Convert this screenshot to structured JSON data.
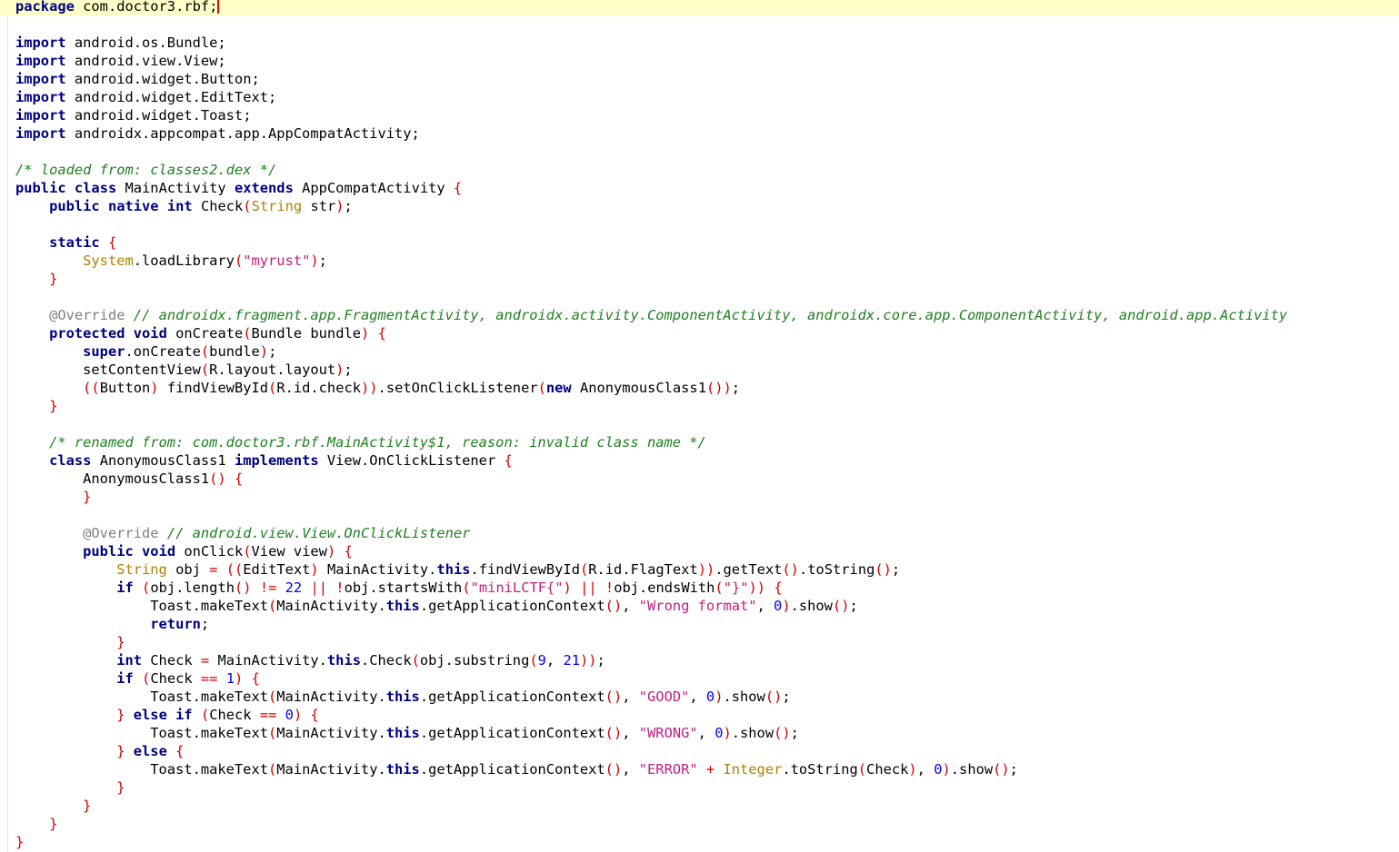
{
  "colors": {
    "keyword": "#000080",
    "bracket": "#d00000",
    "string": "#c02080",
    "number": "#0000ff",
    "comment": "#208020",
    "annotation": "#808080",
    "builtin_type": "#b08000",
    "current_line_bg": "#ffffc8"
  },
  "lines": [
    [
      {
        "t": "package",
        "c": "kw"
      },
      {
        "t": " com.doctor3.rbf;"
      }
    ],
    [],
    [
      {
        "t": "import",
        "c": "kw"
      },
      {
        "t": " android.os.Bundle;"
      }
    ],
    [
      {
        "t": "import",
        "c": "kw"
      },
      {
        "t": " android.view.View;"
      }
    ],
    [
      {
        "t": "import",
        "c": "kw"
      },
      {
        "t": " android.widget.Button;"
      }
    ],
    [
      {
        "t": "import",
        "c": "kw"
      },
      {
        "t": " android.widget.EditText;"
      }
    ],
    [
      {
        "t": "import",
        "c": "kw"
      },
      {
        "t": " android.widget.Toast;"
      }
    ],
    [
      {
        "t": "import",
        "c": "kw"
      },
      {
        "t": " androidx.appcompat.app.AppCompatActivity;"
      }
    ],
    [],
    [
      {
        "t": "/* loaded from: classes2.dex */",
        "c": "cmt"
      }
    ],
    [
      {
        "t": "public",
        "c": "kw"
      },
      {
        "t": " "
      },
      {
        "t": "class",
        "c": "kw"
      },
      {
        "t": " MainActivity "
      },
      {
        "t": "extends",
        "c": "kw"
      },
      {
        "t": " AppCompatActivity "
      },
      {
        "t": "{",
        "c": "br"
      }
    ],
    [
      {
        "t": "    "
      },
      {
        "t": "public",
        "c": "kw"
      },
      {
        "t": " "
      },
      {
        "t": "native",
        "c": "kw"
      },
      {
        "t": " "
      },
      {
        "t": "int",
        "c": "ty"
      },
      {
        "t": " Check"
      },
      {
        "t": "(",
        "c": "br"
      },
      {
        "t": "String",
        "c": "tk"
      },
      {
        "t": " str"
      },
      {
        "t": ")",
        "c": "br"
      },
      {
        "t": ";"
      }
    ],
    [],
    [
      {
        "t": "    "
      },
      {
        "t": "static",
        "c": "kw"
      },
      {
        "t": " "
      },
      {
        "t": "{",
        "c": "br"
      }
    ],
    [
      {
        "t": "        "
      },
      {
        "t": "System",
        "c": "tk"
      },
      {
        "t": ".loadLibrary"
      },
      {
        "t": "(",
        "c": "br"
      },
      {
        "t": "\"myrust\"",
        "c": "str"
      },
      {
        "t": ")",
        "c": "br"
      },
      {
        "t": ";"
      }
    ],
    [
      {
        "t": "    "
      },
      {
        "t": "}",
        "c": "br"
      }
    ],
    [],
    [
      {
        "t": "    "
      },
      {
        "t": "@Override",
        "c": "ann"
      },
      {
        "t": " "
      },
      {
        "t": "// androidx.fragment.app.FragmentActivity, androidx.activity.ComponentActivity, androidx.core.app.ComponentActivity, android.app.Activity",
        "c": "cmt"
      }
    ],
    [
      {
        "t": "    "
      },
      {
        "t": "protected",
        "c": "kw"
      },
      {
        "t": " "
      },
      {
        "t": "void",
        "c": "ty"
      },
      {
        "t": " onCreate"
      },
      {
        "t": "(",
        "c": "br"
      },
      {
        "t": "Bundle bundle"
      },
      {
        "t": ")",
        "c": "br"
      },
      {
        "t": " "
      },
      {
        "t": "{",
        "c": "br"
      }
    ],
    [
      {
        "t": "        "
      },
      {
        "t": "super",
        "c": "kw"
      },
      {
        "t": ".onCreate"
      },
      {
        "t": "(",
        "c": "br"
      },
      {
        "t": "bundle"
      },
      {
        "t": ")",
        "c": "br"
      },
      {
        "t": ";"
      }
    ],
    [
      {
        "t": "        setContentView"
      },
      {
        "t": "(",
        "c": "br"
      },
      {
        "t": "R.layout.layout"
      },
      {
        "t": ")",
        "c": "br"
      },
      {
        "t": ";"
      }
    ],
    [
      {
        "t": "        "
      },
      {
        "t": "((",
        "c": "br"
      },
      {
        "t": "Button"
      },
      {
        "t": ")",
        "c": "br"
      },
      {
        "t": " findViewById"
      },
      {
        "t": "(",
        "c": "br"
      },
      {
        "t": "R.id.check"
      },
      {
        "t": "))",
        "c": "br"
      },
      {
        "t": ".setOnClickListener"
      },
      {
        "t": "(",
        "c": "br"
      },
      {
        "t": "new",
        "c": "kw"
      },
      {
        "t": " AnonymousClass1"
      },
      {
        "t": "())",
        "c": "br"
      },
      {
        "t": ";"
      }
    ],
    [
      {
        "t": "    "
      },
      {
        "t": "}",
        "c": "br"
      }
    ],
    [],
    [
      {
        "t": "    "
      },
      {
        "t": "/* renamed from: com.doctor3.rbf.MainActivity$1, reason: invalid class name */",
        "c": "cmt"
      }
    ],
    [
      {
        "t": "    "
      },
      {
        "t": "class",
        "c": "kw"
      },
      {
        "t": " AnonymousClass1 "
      },
      {
        "t": "implements",
        "c": "kw"
      },
      {
        "t": " View.OnClickListener "
      },
      {
        "t": "{",
        "c": "br"
      }
    ],
    [
      {
        "t": "        AnonymousClass1"
      },
      {
        "t": "()",
        "c": "br"
      },
      {
        "t": " "
      },
      {
        "t": "{",
        "c": "br"
      }
    ],
    [
      {
        "t": "        "
      },
      {
        "t": "}",
        "c": "br"
      }
    ],
    [],
    [
      {
        "t": "        "
      },
      {
        "t": "@Override",
        "c": "ann"
      },
      {
        "t": " "
      },
      {
        "t": "// android.view.View.OnClickListener",
        "c": "cmt"
      }
    ],
    [
      {
        "t": "        "
      },
      {
        "t": "public",
        "c": "kw"
      },
      {
        "t": " "
      },
      {
        "t": "void",
        "c": "ty"
      },
      {
        "t": " onClick"
      },
      {
        "t": "(",
        "c": "br"
      },
      {
        "t": "View view"
      },
      {
        "t": ")",
        "c": "br"
      },
      {
        "t": " "
      },
      {
        "t": "{",
        "c": "br"
      }
    ],
    [
      {
        "t": "            "
      },
      {
        "t": "String",
        "c": "tk"
      },
      {
        "t": " obj "
      },
      {
        "t": "=",
        "c": "br"
      },
      {
        "t": " "
      },
      {
        "t": "((",
        "c": "br"
      },
      {
        "t": "EditText"
      },
      {
        "t": ")",
        "c": "br"
      },
      {
        "t": " MainActivity."
      },
      {
        "t": "this",
        "c": "kw"
      },
      {
        "t": ".findViewById"
      },
      {
        "t": "(",
        "c": "br"
      },
      {
        "t": "R.id.FlagText"
      },
      {
        "t": "))",
        "c": "br"
      },
      {
        "t": ".getText"
      },
      {
        "t": "()",
        "c": "br"
      },
      {
        "t": ".toString"
      },
      {
        "t": "()",
        "c": "br"
      },
      {
        "t": ";"
      }
    ],
    [
      {
        "t": "            "
      },
      {
        "t": "if",
        "c": "kw"
      },
      {
        "t": " "
      },
      {
        "t": "(",
        "c": "br"
      },
      {
        "t": "obj.length"
      },
      {
        "t": "()",
        "c": "br"
      },
      {
        "t": " "
      },
      {
        "t": "!=",
        "c": "br"
      },
      {
        "t": " "
      },
      {
        "t": "22",
        "c": "num"
      },
      {
        "t": " "
      },
      {
        "t": "||",
        "c": "br"
      },
      {
        "t": " "
      },
      {
        "t": "!",
        "c": "br"
      },
      {
        "t": "obj.startsWith"
      },
      {
        "t": "(",
        "c": "br"
      },
      {
        "t": "\"miniLCTF{\"",
        "c": "str"
      },
      {
        "t": ")",
        "c": "br"
      },
      {
        "t": " "
      },
      {
        "t": "||",
        "c": "br"
      },
      {
        "t": " "
      },
      {
        "t": "!",
        "c": "br"
      },
      {
        "t": "obj.endsWith"
      },
      {
        "t": "(",
        "c": "br"
      },
      {
        "t": "\"}\"",
        "c": "str"
      },
      {
        "t": "))",
        "c": "br"
      },
      {
        "t": " "
      },
      {
        "t": "{",
        "c": "br"
      }
    ],
    [
      {
        "t": "                Toast.makeText"
      },
      {
        "t": "(",
        "c": "br"
      },
      {
        "t": "MainActivity."
      },
      {
        "t": "this",
        "c": "kw"
      },
      {
        "t": ".getApplicationContext"
      },
      {
        "t": "()",
        "c": "br"
      },
      {
        "t": ", "
      },
      {
        "t": "\"Wrong format\"",
        "c": "str"
      },
      {
        "t": ", "
      },
      {
        "t": "0",
        "c": "num"
      },
      {
        "t": ")",
        "c": "br"
      },
      {
        "t": ".show"
      },
      {
        "t": "()",
        "c": "br"
      },
      {
        "t": ";"
      }
    ],
    [
      {
        "t": "                "
      },
      {
        "t": "return",
        "c": "kw"
      },
      {
        "t": ";"
      }
    ],
    [
      {
        "t": "            "
      },
      {
        "t": "}",
        "c": "br"
      }
    ],
    [
      {
        "t": "            "
      },
      {
        "t": "int",
        "c": "ty"
      },
      {
        "t": " Check "
      },
      {
        "t": "=",
        "c": "br"
      },
      {
        "t": " MainActivity."
      },
      {
        "t": "this",
        "c": "kw"
      },
      {
        "t": ".Check"
      },
      {
        "t": "(",
        "c": "br"
      },
      {
        "t": "obj.substring"
      },
      {
        "t": "(",
        "c": "br"
      },
      {
        "t": "9",
        "c": "num"
      },
      {
        "t": ", "
      },
      {
        "t": "21",
        "c": "num"
      },
      {
        "t": "))",
        "c": "br"
      },
      {
        "t": ";"
      }
    ],
    [
      {
        "t": "            "
      },
      {
        "t": "if",
        "c": "kw"
      },
      {
        "t": " "
      },
      {
        "t": "(",
        "c": "br"
      },
      {
        "t": "Check "
      },
      {
        "t": "==",
        "c": "br"
      },
      {
        "t": " "
      },
      {
        "t": "1",
        "c": "num"
      },
      {
        "t": ")",
        "c": "br"
      },
      {
        "t": " "
      },
      {
        "t": "{",
        "c": "br"
      }
    ],
    [
      {
        "t": "                Toast.makeText"
      },
      {
        "t": "(",
        "c": "br"
      },
      {
        "t": "MainActivity."
      },
      {
        "t": "this",
        "c": "kw"
      },
      {
        "t": ".getApplicationContext"
      },
      {
        "t": "()",
        "c": "br"
      },
      {
        "t": ", "
      },
      {
        "t": "\"GOOD\"",
        "c": "str"
      },
      {
        "t": ", "
      },
      {
        "t": "0",
        "c": "num"
      },
      {
        "t": ")",
        "c": "br"
      },
      {
        "t": ".show"
      },
      {
        "t": "()",
        "c": "br"
      },
      {
        "t": ";"
      }
    ],
    [
      {
        "t": "            "
      },
      {
        "t": "}",
        "c": "br"
      },
      {
        "t": " "
      },
      {
        "t": "else",
        "c": "kw"
      },
      {
        "t": " "
      },
      {
        "t": "if",
        "c": "kw"
      },
      {
        "t": " "
      },
      {
        "t": "(",
        "c": "br"
      },
      {
        "t": "Check "
      },
      {
        "t": "==",
        "c": "br"
      },
      {
        "t": " "
      },
      {
        "t": "0",
        "c": "num"
      },
      {
        "t": ")",
        "c": "br"
      },
      {
        "t": " "
      },
      {
        "t": "{",
        "c": "br"
      }
    ],
    [
      {
        "t": "                Toast.makeText"
      },
      {
        "t": "(",
        "c": "br"
      },
      {
        "t": "MainActivity."
      },
      {
        "t": "this",
        "c": "kw"
      },
      {
        "t": ".getApplicationContext"
      },
      {
        "t": "()",
        "c": "br"
      },
      {
        "t": ", "
      },
      {
        "t": "\"WRONG\"",
        "c": "str"
      },
      {
        "t": ", "
      },
      {
        "t": "0",
        "c": "num"
      },
      {
        "t": ")",
        "c": "br"
      },
      {
        "t": ".show"
      },
      {
        "t": "()",
        "c": "br"
      },
      {
        "t": ";"
      }
    ],
    [
      {
        "t": "            "
      },
      {
        "t": "}",
        "c": "br"
      },
      {
        "t": " "
      },
      {
        "t": "else",
        "c": "kw"
      },
      {
        "t": " "
      },
      {
        "t": "{",
        "c": "br"
      }
    ],
    [
      {
        "t": "                Toast.makeText"
      },
      {
        "t": "(",
        "c": "br"
      },
      {
        "t": "MainActivity."
      },
      {
        "t": "this",
        "c": "kw"
      },
      {
        "t": ".getApplicationContext"
      },
      {
        "t": "()",
        "c": "br"
      },
      {
        "t": ", "
      },
      {
        "t": "\"ERROR\"",
        "c": "str"
      },
      {
        "t": " "
      },
      {
        "t": "+",
        "c": "br"
      },
      {
        "t": " "
      },
      {
        "t": "Integer",
        "c": "tk"
      },
      {
        "t": ".toString"
      },
      {
        "t": "(",
        "c": "br"
      },
      {
        "t": "Check"
      },
      {
        "t": ")",
        "c": "br"
      },
      {
        "t": ", "
      },
      {
        "t": "0",
        "c": "num"
      },
      {
        "t": ")",
        "c": "br"
      },
      {
        "t": ".show"
      },
      {
        "t": "()",
        "c": "br"
      },
      {
        "t": ";"
      }
    ],
    [
      {
        "t": "            "
      },
      {
        "t": "}",
        "c": "br"
      }
    ],
    [
      {
        "t": "        "
      },
      {
        "t": "}",
        "c": "br"
      }
    ],
    [
      {
        "t": "    "
      },
      {
        "t": "}",
        "c": "br"
      }
    ],
    [
      {
        "t": "}",
        "c": "br"
      }
    ]
  ]
}
